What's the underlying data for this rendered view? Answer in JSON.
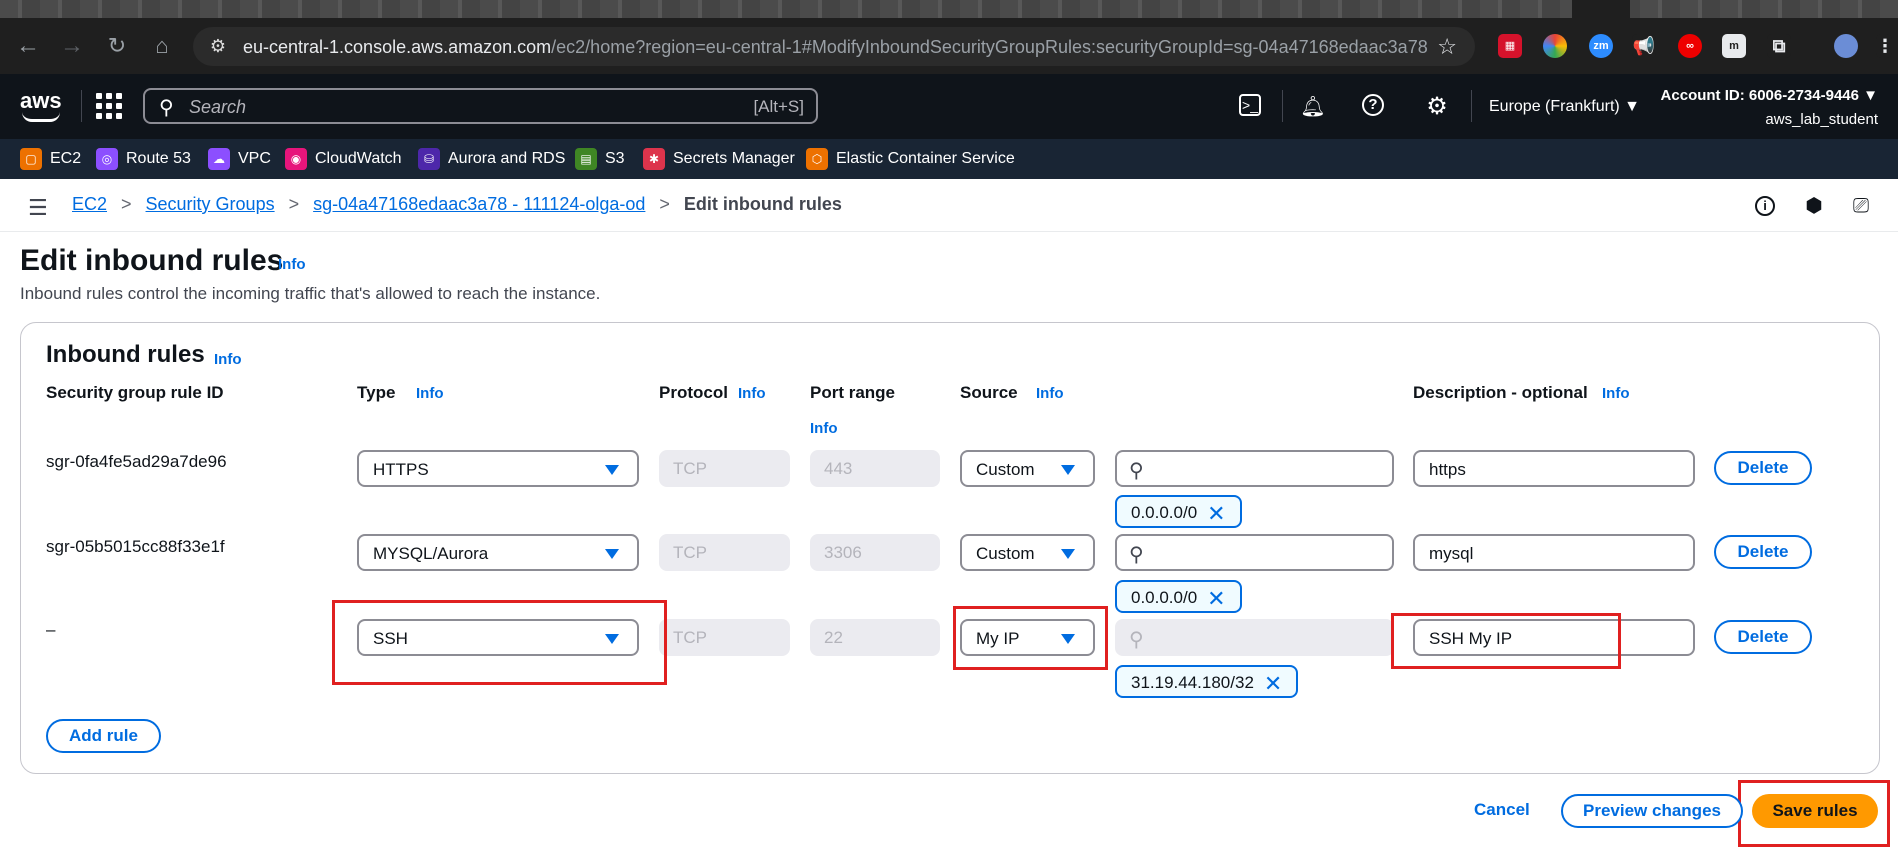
{
  "browser": {
    "url_host": "eu-central-1.console.aws.amazon.com",
    "url_path": "/ec2/home?region=eu-central-1#ModifyInboundSecurityGroupRules:securityGroupId=sg-04a47168edaac3a78"
  },
  "aws_nav": {
    "logo": "aws",
    "search_placeholder": "Search",
    "search_shortcut": "[Alt+S]",
    "region": "Europe (Frankfurt) ▼",
    "account_id": "Account ID: 6006-2734-9446 ▼",
    "username": "aws_lab_student"
  },
  "favorites": [
    {
      "label": "EC2",
      "color": "#ed7100"
    },
    {
      "label": "Route 53",
      "color": "#8c4fff"
    },
    {
      "label": "VPC",
      "color": "#8c4fff"
    },
    {
      "label": "CloudWatch",
      "color": "#e7157b"
    },
    {
      "label": "Aurora and RDS",
      "color": "#4d27aa"
    },
    {
      "label": "S3",
      "color": "#3f8624"
    },
    {
      "label": "Secrets Manager",
      "color": "#dd344c"
    },
    {
      "label": "Elastic Container Service",
      "color": "#ed7100"
    }
  ],
  "breadcrumb": {
    "ec2": "EC2",
    "security_groups": "Security Groups",
    "sg": "sg-04a47168edaac3a78 - 111124-olga-od",
    "current": "Edit inbound rules"
  },
  "page": {
    "title": "Edit inbound rules",
    "info": "Info",
    "description": "Inbound rules control the incoming traffic that's allowed to reach the instance."
  },
  "container": {
    "title": "Inbound rules",
    "info": "Info",
    "columns": {
      "rule_id": "Security group rule ID",
      "type": "Type",
      "protocol": "Protocol",
      "port_range": "Port range",
      "source": "Source",
      "description": "Description - optional",
      "info": "Info"
    },
    "rules": [
      {
        "id": "sgr-0fa4fe5ad29a7de96",
        "type": "HTTPS",
        "protocol": "TCP",
        "port": "443",
        "source": "Custom",
        "token": "0.0.0.0/0",
        "description": "https",
        "delete": "Delete"
      },
      {
        "id": "sgr-05b5015cc88f33e1f",
        "type": "MYSQL/Aurora",
        "protocol": "TCP",
        "port": "3306",
        "source": "Custom",
        "token": "0.0.0.0/0",
        "description": "mysql",
        "delete": "Delete"
      },
      {
        "id": "–",
        "type": "SSH",
        "protocol": "TCP",
        "port": "22",
        "source": "My IP",
        "token": "31.19.44.180/32",
        "description": "SSH My IP",
        "delete": "Delete"
      }
    ],
    "add_rule": "Add rule"
  },
  "footer": {
    "cancel": "Cancel",
    "preview": "Preview changes",
    "save": "Save rules"
  },
  "colors": {
    "link": "#006ce0",
    "primary_button": "#ff9900",
    "highlight": "#e02020"
  }
}
